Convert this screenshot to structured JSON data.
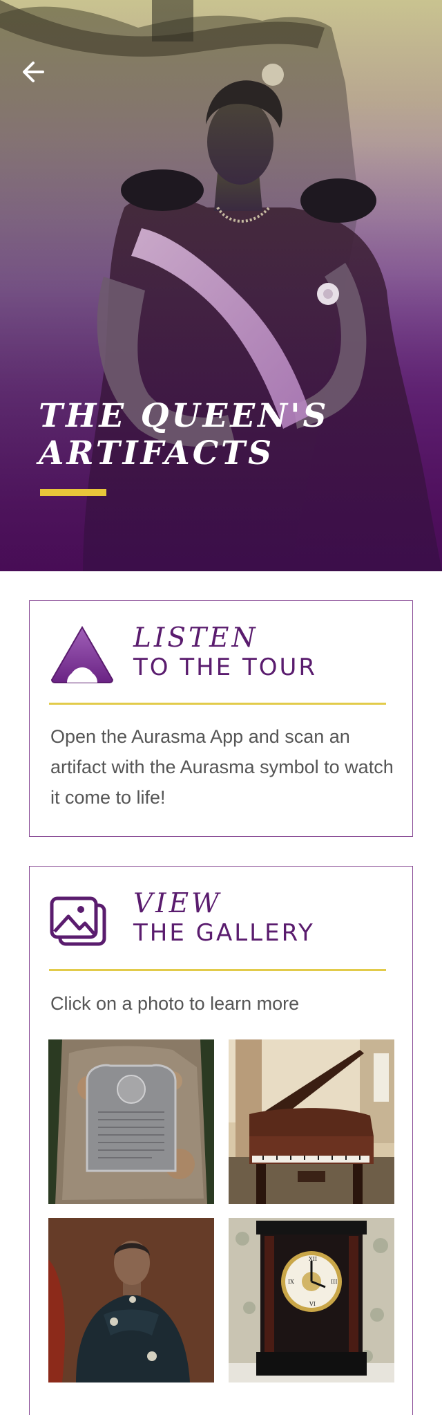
{
  "hero": {
    "back_icon": "arrow-left-icon",
    "title_line1": "THE QUEEN'S",
    "title_line2": "ARTIFACTS",
    "accent_color": "#e8c63a",
    "overlay_color": "#4e0f5c"
  },
  "listen": {
    "icon": "aurasma-logo-icon",
    "title_italic": "LISTEN",
    "title_caps": "TO THE TOUR",
    "body": "Open the Aurasma App and scan an artifact with the Aurasma symbol to watch it come to life!"
  },
  "gallery": {
    "icon": "gallery-icon",
    "title_italic": "VIEW",
    "title_caps": "THE GALLERY",
    "subtitle": "Click on a photo to learn more",
    "items": [
      {
        "name": "plaque"
      },
      {
        "name": "piano"
      },
      {
        "name": "portrait"
      },
      {
        "name": "clock"
      }
    ]
  },
  "colors": {
    "brand_purple": "#5a1c6e",
    "divider_gold": "#e2cb4a",
    "card_border": "#8a4d96"
  }
}
